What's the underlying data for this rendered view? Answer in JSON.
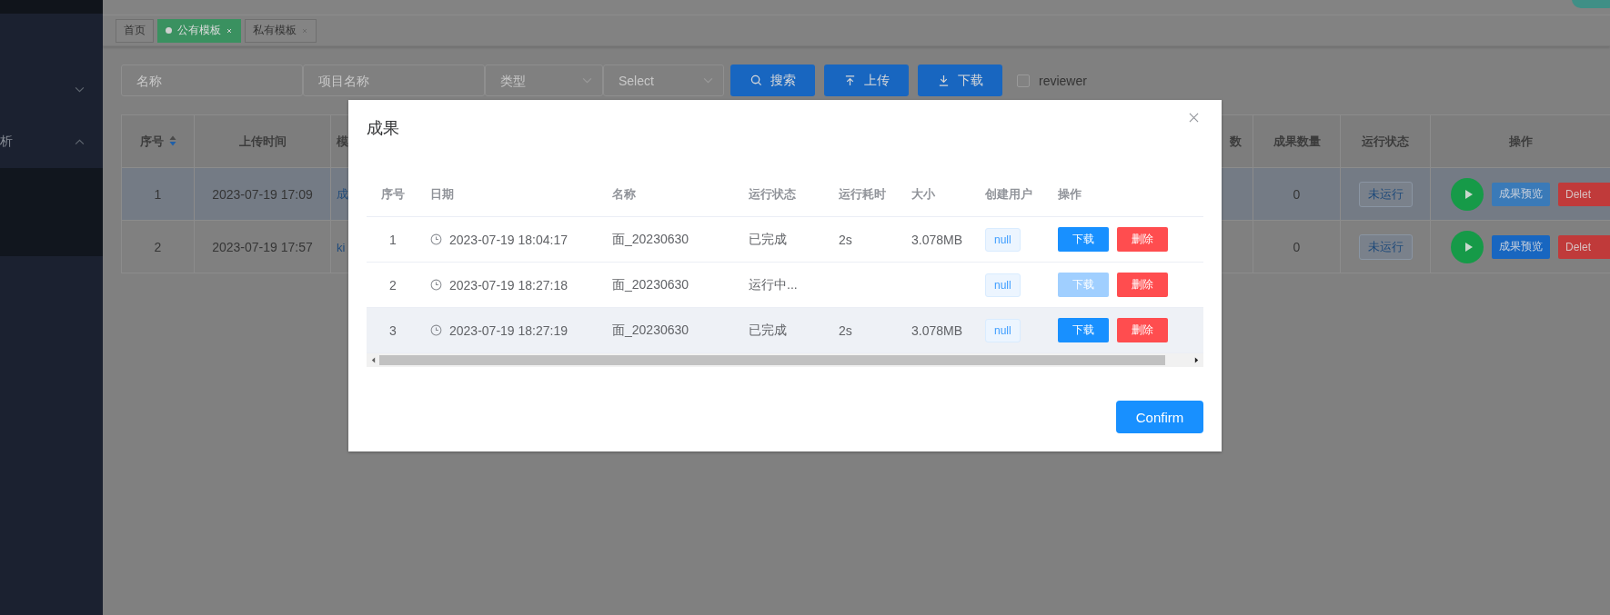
{
  "sidebar": {
    "items": [
      {
        "expanded": false
      },
      {
        "label": "析",
        "expanded": true
      }
    ]
  },
  "tags": [
    {
      "label": "首页",
      "selected": false,
      "closable": false
    },
    {
      "label": "公有模板",
      "selected": true,
      "closable": true
    },
    {
      "label": "私有模板",
      "selected": false,
      "closable": true
    }
  ],
  "filters": {
    "fields": [
      {
        "kind": "input",
        "placeholder": "名称"
      },
      {
        "kind": "input",
        "placeholder": "项目名称"
      },
      {
        "kind": "select",
        "placeholder": "类型"
      },
      {
        "kind": "select",
        "placeholder": "Select"
      }
    ],
    "buttons": [
      {
        "kind": "search",
        "label": "搜索"
      },
      {
        "kind": "upload",
        "label": "上传"
      },
      {
        "kind": "download",
        "label": "下载"
      }
    ],
    "reviewer": {
      "label": "reviewer",
      "checked": false
    }
  },
  "table": {
    "columns": [
      "序号",
      "上传时间",
      "模",
      "数",
      "成果数量",
      "运行状态",
      "操作"
    ],
    "rows": [
      {
        "selected": true,
        "index": "1",
        "uploaded": "2023-07-19 17:09",
        "column_3": "成",
        "count": "0",
        "status": "未运行",
        "actions": [
          "成果预览",
          "Delet"
        ]
      },
      {
        "selected": false,
        "index": "2",
        "uploaded": "2023-07-19 17:57",
        "column_3": "ki",
        "count": "0",
        "status": "未运行",
        "actions": [
          "成果预览",
          "Delet"
        ]
      }
    ]
  },
  "dialog": {
    "title": "成果",
    "columns": [
      "序号",
      "日期",
      "名称",
      "运行状态",
      "运行耗时",
      "大小",
      "创建用户",
      "操作"
    ],
    "rows": [
      {
        "index": "1",
        "date": "2023-07-19 18:04:17",
        "name": "面_20230630",
        "status": "已完成",
        "duration": "2s",
        "size": "3.078MB",
        "user": "null",
        "download": {
          "label": "下载",
          "disabled": false
        },
        "delete": "删除",
        "hovered": false
      },
      {
        "index": "2",
        "date": "2023-07-19 18:27:18",
        "name": "面_20230630",
        "status": "运行中...",
        "user": "null",
        "download": {
          "label": "下载",
          "disabled": true
        },
        "delete": "删除",
        "hovered": false
      },
      {
        "index": "3",
        "date": "2023-07-19 18:27:19",
        "name": "面_20230630",
        "status": "已完成",
        "duration": "2s",
        "size": "3.078MB",
        "user": "null",
        "download": {
          "label": "下载",
          "disabled": false
        },
        "delete": "删除",
        "hovered": true
      }
    ],
    "confirm": "Confirm"
  }
}
